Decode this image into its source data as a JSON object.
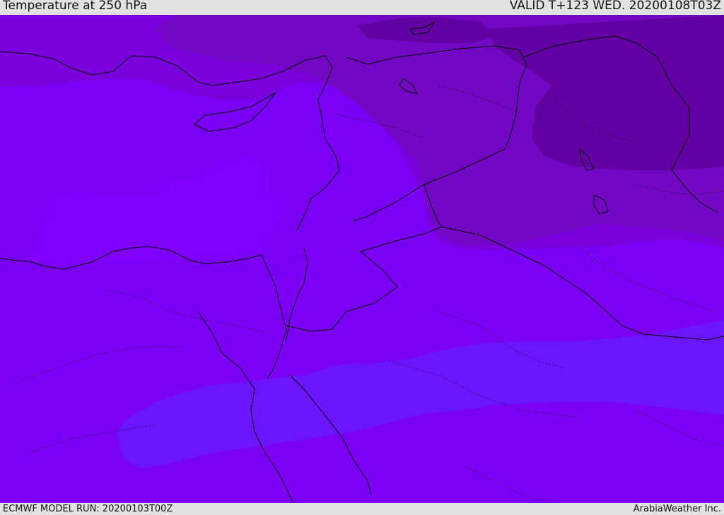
{
  "header": {
    "title": "Temperature at 250 hPa",
    "valid": "VALID T+123 WED. 20200108T03Z"
  },
  "footer": {
    "model_run": "ECMWF MODEL RUN: 20200103T00Z",
    "brand": "ArabiaWeather Inc."
  },
  "map": {
    "field": "Temperature at 250 hPa",
    "color_bands": {
      "darkest": "#6300a3",
      "dark": "#6e0ab9",
      "mid_dark": "#7800da",
      "mid": "#7d00f4",
      "brightest": "#8000ff",
      "blue_band": "#6a14fe"
    },
    "coastline_color": "#000000",
    "border_style": "dotted"
  }
}
